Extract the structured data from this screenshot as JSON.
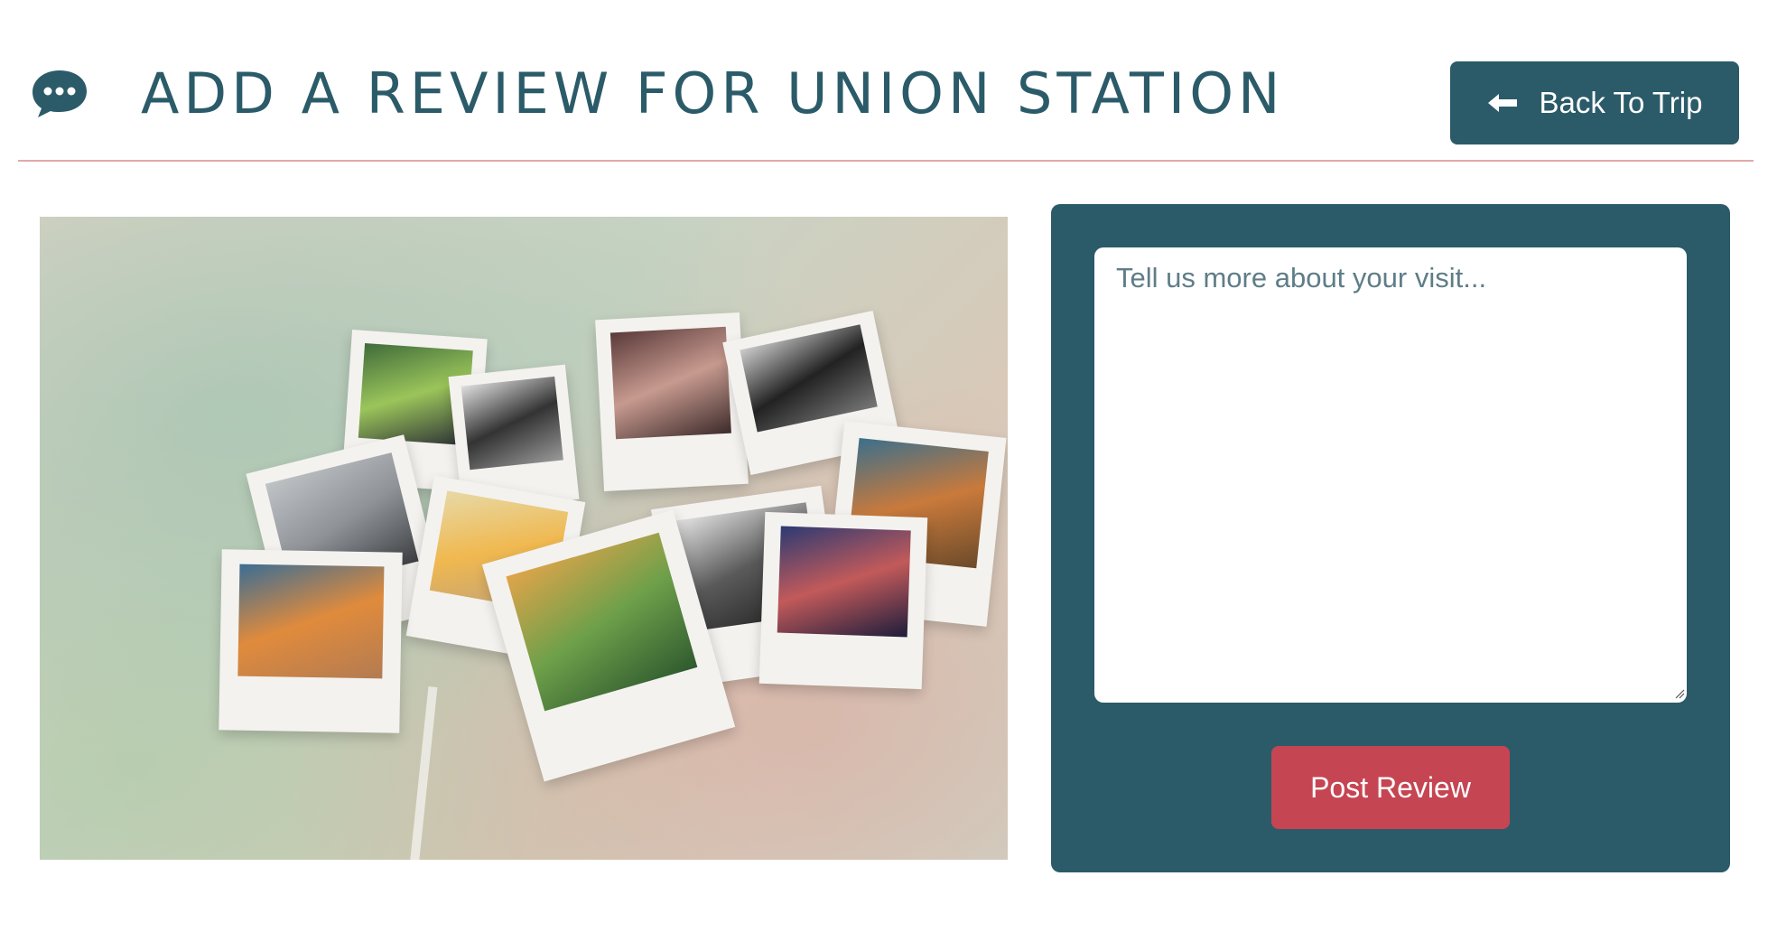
{
  "header": {
    "icon": "chat-bubble-icon",
    "title": "ADD A REVIEW FOR UNION STATION",
    "back_button": {
      "icon": "arrow-left-icon",
      "label": "Back To Trip"
    }
  },
  "colors": {
    "primary": "#2b5b69",
    "accent": "#c64553",
    "divider": "#e1a9a9",
    "background": "#ffffff"
  },
  "image": {
    "alt": "Instant photos scattered on a map"
  },
  "review_form": {
    "placeholder": "Tell us more about your visit...",
    "value": "",
    "submit_label": "Post Review"
  }
}
